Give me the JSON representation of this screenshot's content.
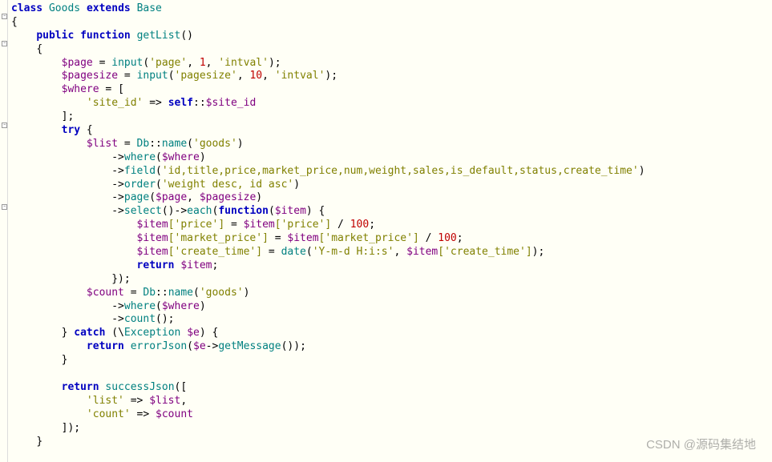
{
  "code": {
    "l1": {
      "kw1": "class",
      "cls": "Goods",
      "kw2": "extends",
      "base": "Base"
    },
    "l2": "{",
    "l3": {
      "kw1": "public",
      "kw2": "function",
      "fn": "getList",
      "p": "()"
    },
    "l4": "{",
    "l5": {
      "v": "$page",
      "eq": " = ",
      "fn": "input",
      "o": "(",
      "s1": "'page'",
      "c1": ", ",
      "n": "1",
      "c2": ", ",
      "s2": "'intval'",
      "cl": ");"
    },
    "l6": {
      "v": "$pagesize",
      "eq": " = ",
      "fn": "input",
      "o": "(",
      "s1": "'pagesize'",
      "c1": ", ",
      "n": "10",
      "c2": ", ",
      "s2": "'intval'",
      "cl": ");"
    },
    "l7": {
      "v": "$where",
      "eq": " = ["
    },
    "l8": {
      "s": "'site_id'",
      "arr": " => ",
      "kw": "self",
      "sc": "::",
      "v": "$site_id"
    },
    "l9": "];",
    "l10": {
      "kw": "try",
      "b": " {"
    },
    "l11": {
      "v": "$list",
      "eq": " = ",
      "cls": "Db",
      "sc": "::",
      "fn": "name",
      "o": "(",
      "s": "'goods'",
      "cl": ")"
    },
    "l12": {
      "arr": "->",
      "fn": "where",
      "o": "(",
      "v": "$where",
      "cl": ")"
    },
    "l13": {
      "arr": "->",
      "fn": "field",
      "o": "(",
      "s": "'id,title,price,market_price,num,weight,sales,is_default,status,create_time'",
      "cl": ")"
    },
    "l14": {
      "arr": "->",
      "fn": "order",
      "o": "(",
      "s": "'weight desc, id asc'",
      "cl": ")"
    },
    "l15": {
      "arr": "->",
      "fn": "page",
      "o": "(",
      "v1": "$page",
      "c": ", ",
      "v2": "$pagesize",
      "cl": ")"
    },
    "l16": {
      "arr": "->",
      "fn1": "select",
      "p1": "()",
      "arr2": "->",
      "fn2": "each",
      "o": "(",
      "kw": "function",
      "po": "(",
      "v": "$item",
      "pc": ") {"
    },
    "l17": {
      "v1": "$item",
      "k1": "['price']",
      "eq": " = ",
      "v2": "$item",
      "k2": "['price']",
      "op": " / ",
      "n": "100",
      "sc": ";"
    },
    "l18": {
      "v1": "$item",
      "k1": "['market_price']",
      "eq": " = ",
      "v2": "$item",
      "k2": "['market_price']",
      "op": " / ",
      "n": "100",
      "sc": ";"
    },
    "l19": {
      "v1": "$item",
      "k1": "['create_time']",
      "eq": " = ",
      "fn": "date",
      "o": "(",
      "s": "'Y-m-d H:i:s'",
      "c": ", ",
      "v2": "$item",
      "k2": "['create_time']",
      "cl": ");"
    },
    "l20": {
      "kw": "return",
      "sp": " ",
      "v": "$item",
      "sc": ";"
    },
    "l21": "});",
    "l22": {
      "v": "$count",
      "eq": " = ",
      "cls": "Db",
      "sc": "::",
      "fn": "name",
      "o": "(",
      "s": "'goods'",
      "cl": ")"
    },
    "l23": {
      "arr": "->",
      "fn": "where",
      "o": "(",
      "v": "$where",
      "cl": ")"
    },
    "l24": {
      "arr": "->",
      "fn": "count",
      "p": "();"
    },
    "l25": {
      "cb": "} ",
      "kw": "catch",
      "o": " (\\",
      "cls": "Exception",
      "sp": " ",
      "v": "$e",
      "cl": ") {"
    },
    "l26": {
      "kw": "return",
      "sp": " ",
      "fn": "errorJson",
      "o": "(",
      "v": "$e",
      "arr": "->",
      "m": "getMessage",
      "cl": "());"
    },
    "l27": "}",
    "l28": "",
    "l29": {
      "kw": "return",
      "sp": " ",
      "fn": "successJson",
      "o": "(["
    },
    "l30": {
      "s": "'list'",
      "arr": " => ",
      "v": "$list",
      "c": ","
    },
    "l31": {
      "s": "'count'",
      "arr": " => ",
      "v": "$count"
    },
    "l32": "]);",
    "l33": "}"
  },
  "indent": {
    "i0": "",
    "i1": "    ",
    "i2": "        ",
    "i3": "            ",
    "i4": "                ",
    "i1h": "  ",
    "i3h": "              "
  },
  "watermark": "CSDN @源码集结地"
}
